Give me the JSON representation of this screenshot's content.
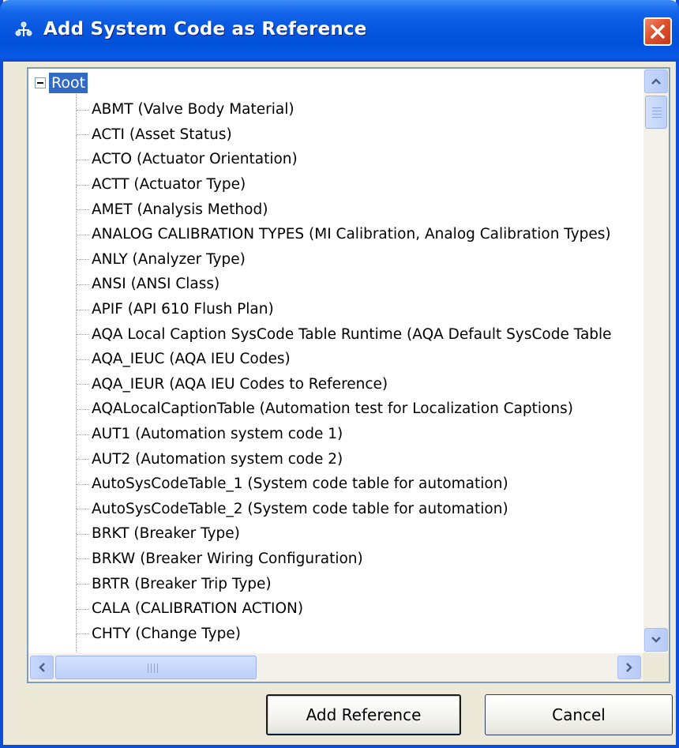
{
  "window": {
    "title": "Add System Code as Reference",
    "title_icon": "network-tree-icon",
    "close_icon": "close-icon"
  },
  "tree": {
    "root": {
      "label": "Root",
      "expanded": true,
      "selected": true
    },
    "items": [
      {
        "label": "ABMT  (Valve Body Material)"
      },
      {
        "label": "ACTI  (Asset Status)"
      },
      {
        "label": "ACTO  (Actuator Orientation)"
      },
      {
        "label": "ACTT  (Actuator Type)"
      },
      {
        "label": "AMET  (Analysis Method)"
      },
      {
        "label": "ANALOG CALIBRATION TYPES  (MI Calibration, Analog Calibration Types)"
      },
      {
        "label": "ANLY  (Analyzer Type)"
      },
      {
        "label": "ANSI  (ANSI Class)"
      },
      {
        "label": "APIF  (API 610 Flush Plan)"
      },
      {
        "label": "AQA Local Caption SysCode Table Runtime  (AQA Default SysCode Table"
      },
      {
        "label": "AQA_IEUC  (AQA IEU Codes)"
      },
      {
        "label": "AQA_IEUR  (AQA IEU Codes to Reference)"
      },
      {
        "label": "AQALocalCaptionTable  (Automation test for Localization Captions)"
      },
      {
        "label": "AUT1  (Automation system code 1)"
      },
      {
        "label": "AUT2  (Automation system code 2)"
      },
      {
        "label": "AutoSysCodeTable_1  (System code table for automation)"
      },
      {
        "label": "AutoSysCodeTable_2  (System code table for automation)"
      },
      {
        "label": "BRKT  (Breaker Type)"
      },
      {
        "label": "BRKW  (Breaker Wiring Configuration)"
      },
      {
        "label": "BRTR  (Breaker Trip Type)"
      },
      {
        "label": "CALA  (CALIBRATION ACTION)"
      },
      {
        "label": "CHTY  (Change Type)"
      }
    ]
  },
  "scrollbars": {
    "vertical": {
      "up_icon": "chevron-up-icon",
      "down_icon": "chevron-down-icon"
    },
    "horizontal": {
      "left_icon": "chevron-left-icon",
      "right_icon": "chevron-right-icon"
    }
  },
  "buttons": {
    "add_reference": "Add Reference",
    "cancel": "Cancel"
  }
}
